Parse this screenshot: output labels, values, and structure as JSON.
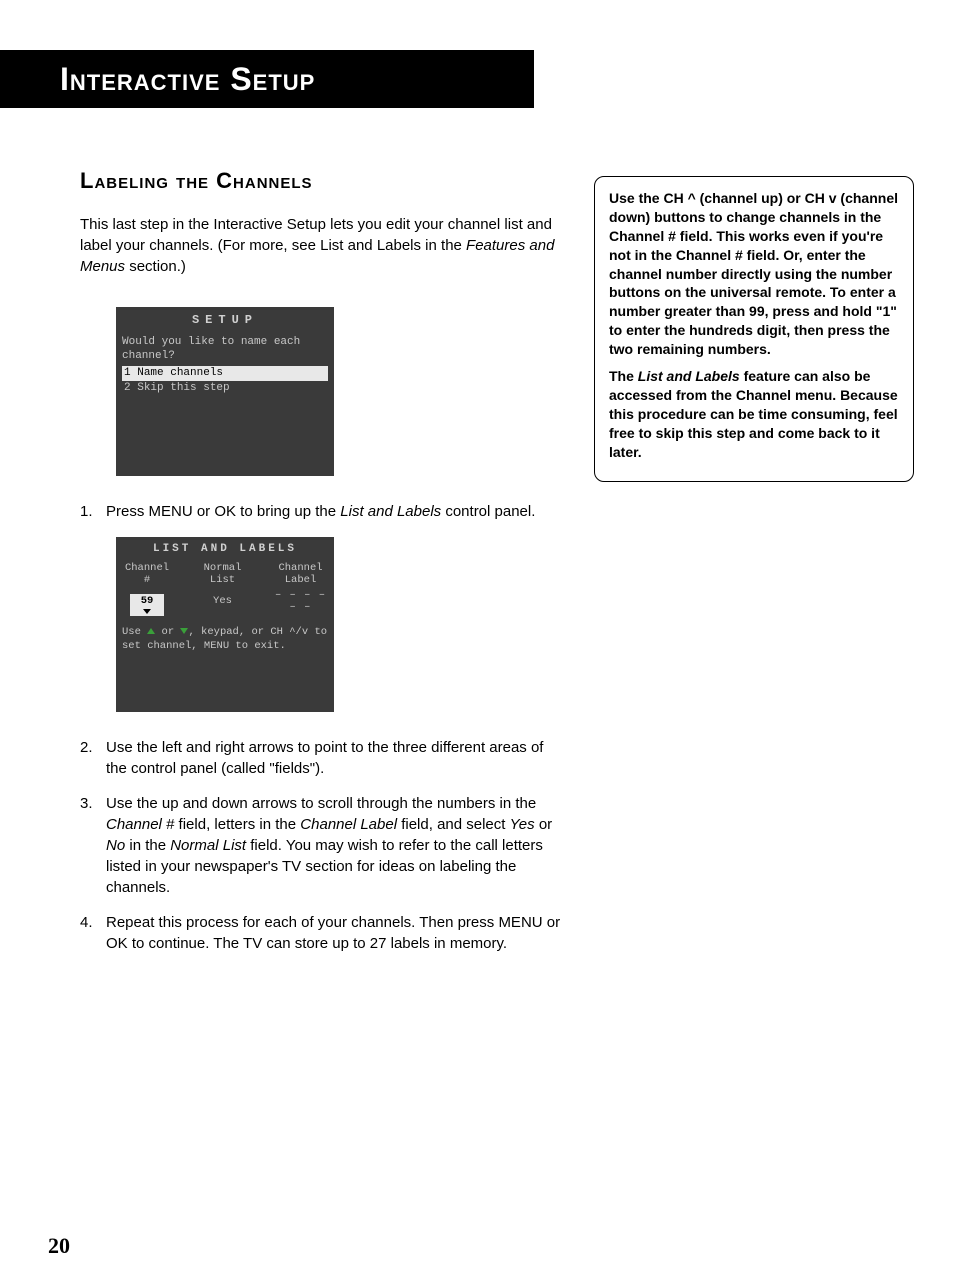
{
  "page": {
    "header": "Interactive Setup",
    "section_title": "Labeling the Channels",
    "intro_a": "This last step in the Interactive Setup lets you edit your channel list and label your channels. (For more, see List and Labels in the ",
    "intro_em": "Features and Menus",
    "intro_b": " section.)",
    "page_number": "20"
  },
  "setup_panel": {
    "title": "SETUP",
    "question": "Would you like to name each channel?",
    "options": [
      {
        "num": "1",
        "label": "Name channels",
        "selected": true
      },
      {
        "num": "2",
        "label": "Skip this step",
        "selected": false
      }
    ]
  },
  "steps": {
    "s1": "Press MENU or OK to bring up the ",
    "s1_em": "List and Labels",
    "s1_b": " control panel.",
    "s2": "Use the left and right arrows to point to the three different areas of the control panel (called \"fields\").",
    "s3_a": "Use the up and down arrows to scroll through the numbers in the ",
    "s3_em1": "Channel #",
    "s3_b": " field, letters in the ",
    "s3_em2": "Channel Label",
    "s3_c": " field, and select ",
    "s3_em3": "Yes",
    "s3_d": " or ",
    "s3_em4": "No",
    "s3_e": " in the ",
    "s3_em5": "Normal List",
    "s3_f": " field. You may wish to refer to the call letters listed in your newspaper's TV section for ideas on labeling the channels.",
    "s4": "Repeat this process for each of your channels. Then press MENU or OK to continue. The TV can store up to 27 labels in memory."
  },
  "list_panel": {
    "title": "LIST AND LABELS",
    "h1a": "Channel",
    "h1b": "#",
    "h2a": "Normal",
    "h2b": "List",
    "h3a": "Channel",
    "h3b": "Label",
    "channel_val": "59",
    "normal_val": "Yes",
    "label_val": "– – – – – –",
    "help_a": "Use ",
    "help_b": " or ",
    "help_c": ", keypad, or CH ^/v to set channel, MENU to exit."
  },
  "sidebar": {
    "p1": "Use the CH ^ (channel up) or CH v (channel down) buttons to change channels in the Channel # field. This works even if you're not in the Channel # field. Or, enter the channel number directly using the number buttons on the universal remote. To enter a number greater than 99, press and hold \"1\" to enter the hundreds digit, then press the two remaining numbers.",
    "p2a": "The ",
    "p2_em": "List and Labels",
    "p2b": " feature can also be accessed from the Channel menu. Because this procedure can be time consuming, feel free to skip this step and come back to it later."
  }
}
